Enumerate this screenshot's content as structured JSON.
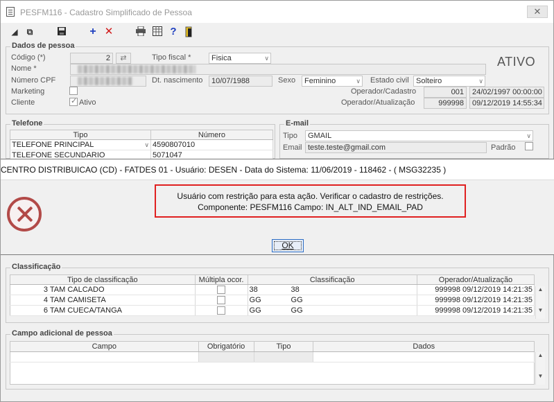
{
  "window": {
    "title": "PESFM116 - Cadastro Simplificado de Pessoa"
  },
  "dados": {
    "section": "Dados de pessoa",
    "codigo_label": "Código (*)",
    "codigo_value": "2",
    "tipo_fiscal_label": "Tipo fiscal *",
    "tipo_fiscal_value": "Fisica",
    "nome_label": "Nome *",
    "cpf_label": "Número CPF",
    "dt_nasc_label": "Dt. nascimento",
    "dt_nasc_value": "10/07/1988",
    "sexo_label": "Sexo",
    "sexo_value": "Feminino",
    "estado_label": "Estado civil",
    "estado_value": "Solteiro",
    "marketing_label": "Marketing",
    "cliente_label": "Cliente",
    "ativo_check_label": "Ativo",
    "status": "ATIVO",
    "op_cad_label": "Operador/Cadastro",
    "op_cad_code": "001",
    "op_cad_date": "24/02/1997 00:00:00",
    "op_atu_label": "Operador/Atualização",
    "op_atu_code": "999998",
    "op_atu_date": "09/12/2019 14:55:34"
  },
  "telefone": {
    "section": "Telefone",
    "col_tipo": "Tipo",
    "col_numero": "Número",
    "rows": [
      {
        "tipo": "TELEFONE PRINCIPAL",
        "numero": "4590807010"
      },
      {
        "tipo": "TELEFONE SECUNDARIO",
        "numero": "5071047"
      }
    ]
  },
  "email": {
    "section": "E-mail",
    "tipo_label": "Tipo",
    "tipo_value": "GMAIL",
    "email_label": "Email",
    "email_value": "teste.teste@gmail.com",
    "padrao_label": "Padrão"
  },
  "dialog": {
    "title": "CENTRO DISTRIBUICAO (CD) - FATDES 01 - Usuário: DESEN - Data do Sistema: 11/06/2019 - 118462 - ( MSG32235 )",
    "line1": "Usuário com restrição para esta ação. Verificar o cadastro de restrições.",
    "line2": "Componente: PESFM116 Campo: IN_ALT_IND_EMAIL_PAD",
    "ok_label": "OK"
  },
  "classificacao": {
    "section": "Classificação",
    "headers": [
      "Tipo de classificação",
      "Múltipla ocor.",
      "Classificação",
      "Operador/Atualização"
    ],
    "rows": [
      {
        "num": "3",
        "tipo": "TAM CALCADO",
        "code": "38",
        "classif": "38",
        "op": "999998",
        "date": "09/12/2019 14:21:35"
      },
      {
        "num": "4",
        "tipo": "TAM CAMISETA",
        "code": "GG",
        "classif": "GG",
        "op": "999998",
        "date": "09/12/2019 14:21:35"
      },
      {
        "num": "6",
        "tipo": "TAM CUECA/TANGA",
        "code": "GG",
        "classif": "GG",
        "op": "999998",
        "date": "09/12/2019 14:21:35"
      }
    ]
  },
  "campo": {
    "section": "Campo adicional de pessoa",
    "headers": [
      "Campo",
      "Obrigatório",
      "Tipo",
      "Dados"
    ]
  }
}
